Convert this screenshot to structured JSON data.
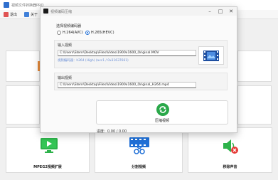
{
  "main_window": {
    "title": "视频文件转换器PRO",
    "menu": [
      "退出",
      "关于"
    ]
  },
  "tiles": {
    "mpeg2": "MPEG2视频扩展",
    "split": "分割视频",
    "remove_audio": "移除声音"
  },
  "dialog": {
    "title": "视频编码压缩",
    "codec_section": "选择视频编码器",
    "codec_options": [
      "H.264(AVC)",
      "H.265(HEVC)"
    ],
    "input_label": "输入视频",
    "input_path": "C:\\Users\\Stern\\Desktop\\Files\\Video\\1900x1600_Original.MOV",
    "input_info": "视频编码器：h264 (High) (avc1 / 0x31637661)",
    "output_label": "输出视频",
    "output_path": "C:\\Users\\Stern\\Desktop\\Files\\Video\\1900x1600_Original_H264.mp4",
    "compress_label": "压缩视频",
    "progress_text": "进度：0.00 / 0.00"
  },
  "colors": {
    "accent": "#1f6fd6",
    "green": "#2db24a",
    "red": "#e53935"
  }
}
